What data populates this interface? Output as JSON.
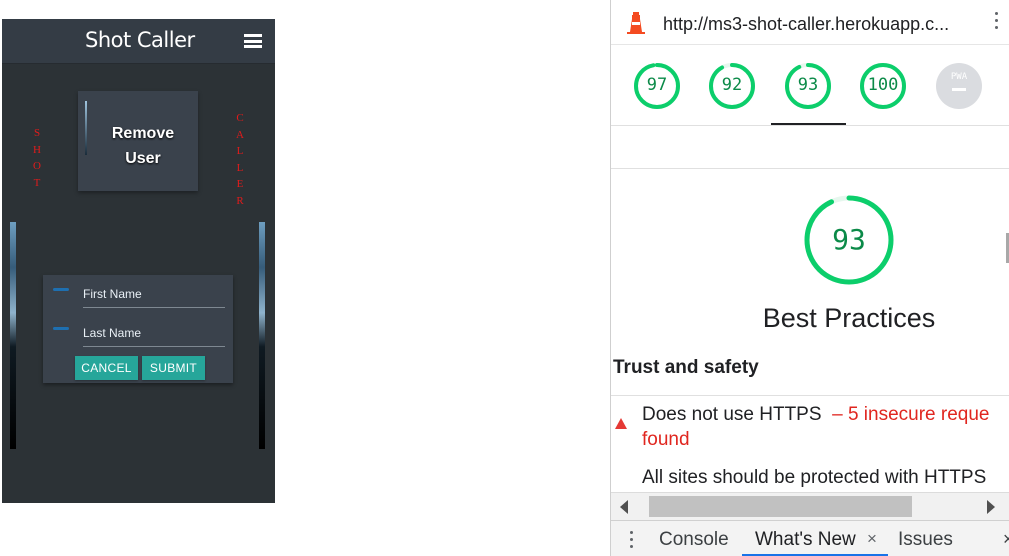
{
  "app": {
    "brand": "Shot Caller",
    "side_left": "SHOT",
    "side_right": "CALLER",
    "card_title_line1": "Remove",
    "card_title_line2": "User",
    "form": {
      "first_name_label": "First Name",
      "last_name_label": "Last Name",
      "cancel_label": "CANCEL",
      "submit_label": "SUBMIT"
    }
  },
  "devtools": {
    "url": "http://ms3-shot-caller.herokuapp.c...",
    "scores": [
      {
        "label": "97",
        "value": 97
      },
      {
        "label": "92",
        "value": 92
      },
      {
        "label": "93",
        "value": 93
      },
      {
        "label": "100",
        "value": 100
      }
    ],
    "pwa_label": "PWA",
    "selected_category_score": "93",
    "selected_category_value": 93,
    "selected_category_title": "Best Practices",
    "group_title": "Trust and safety",
    "audit": {
      "title": "Does not use HTTPS",
      "detail": "– 5 insecure reque",
      "detail_cont": "found",
      "description": "All sites should be protected with HTTPS"
    },
    "drawer_tabs": {
      "console": "Console",
      "whats_new": "What's New",
      "issues": "Issues"
    },
    "close_glyph": "×",
    "colors": {
      "pass": "#0cce6b",
      "pass_text": "#0b8a48",
      "fail": "#e53935",
      "app_bg": "#2c3236",
      "app_card": "#3a424c",
      "button": "#26a69a",
      "side_text": "#e21b1b"
    }
  }
}
